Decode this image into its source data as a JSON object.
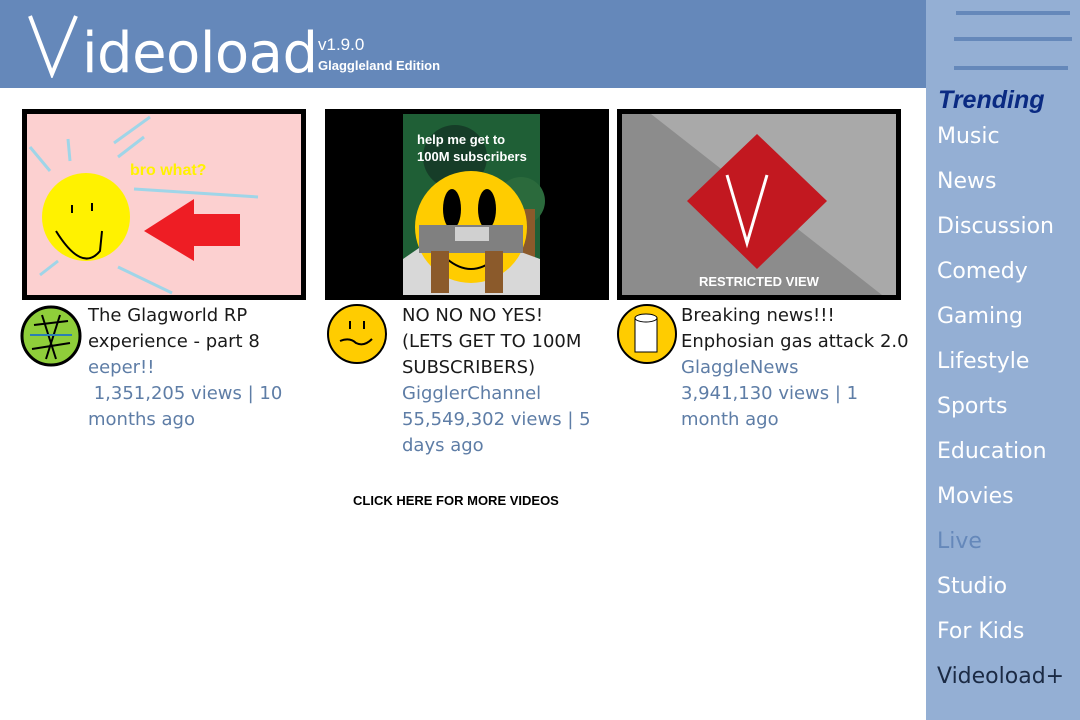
{
  "header": {
    "logo_first": "V",
    "logo_rest": "ideoload",
    "version": "v1.9.0",
    "edition": "Glaggleland Edition"
  },
  "sidebar": {
    "trending": "Trending",
    "items": [
      "Music",
      "News",
      "Discussion",
      "Comedy",
      "Gaming",
      "Lifestyle",
      "Sports",
      "Education",
      "Movies",
      "Live",
      "Studio",
      "For Kids",
      "Videoload+"
    ]
  },
  "videos": [
    {
      "thumb_text": "bro what?",
      "title_line1": "The Glagworld RP",
      "title_line2": "experience - part 8",
      "channel": "eeper!!",
      "meta_line1": " 1,351,205 views | 10",
      "meta_line2": "months ago"
    },
    {
      "thumb_text_line1": "help me get to",
      "thumb_text_line2": "100M subscribers",
      "title_line1": "NO NO NO YES!",
      "title_line2": "(LETS GET TO 100M",
      "title_line3": "SUBSCRIBERS)",
      "channel": "GigglerChannel",
      "meta_line1": "55,549,302 views | 5",
      "meta_line2": "days ago"
    },
    {
      "thumb_text": "RESTRICTED VIEW",
      "title_line1": "Breaking news!!!",
      "title_line2": "Enphosian gas attack 2.0",
      "channel": "GlaggleNews",
      "meta_line1": "3,941,130 views | 1",
      "meta_line2": "month ago"
    }
  ],
  "more_videos": "CLICK HERE FOR MORE VIDEOS",
  "colors": {
    "header_bg": "#6588ba",
    "sidebar_bg": "#94afd4",
    "trending": "#0a2a82",
    "live": "#6588ba",
    "videoload_plus": "#1b2a44",
    "meta": "#5e7da6"
  }
}
